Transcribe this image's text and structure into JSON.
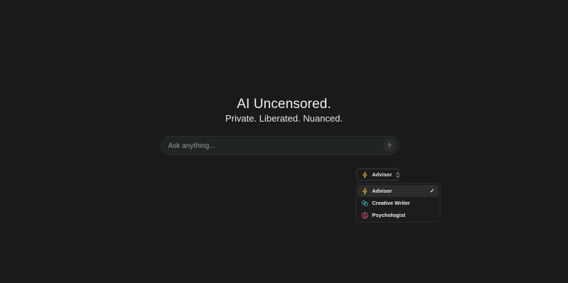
{
  "hero": {
    "title": "AI Uncensored.",
    "subtitle": "Private. Liberated. Nuanced."
  },
  "search": {
    "placeholder": "Ask anything...",
    "send_icon": "arrow-up-icon"
  },
  "persona_selector": {
    "selected": "Advisor",
    "icon": "lightning-icon"
  },
  "persona_menu": {
    "items": [
      {
        "label": "Advisor",
        "icon": "lightning-icon",
        "color": "#e0a63a",
        "selected": true,
        "check": "✓"
      },
      {
        "label": "Creative Writer",
        "icon": "brain-icon",
        "color": "#3bb7c4",
        "selected": false
      },
      {
        "label": "Psychologist",
        "icon": "brain-pink-icon",
        "color": "#e0568a",
        "selected": false
      }
    ]
  }
}
